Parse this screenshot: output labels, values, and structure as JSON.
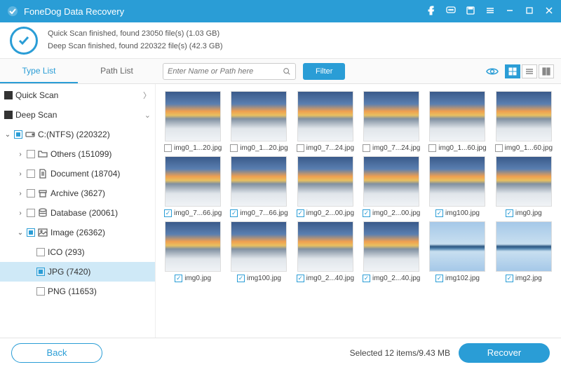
{
  "titlebar": {
    "title": "FoneDog Data Recovery"
  },
  "status": {
    "quick": "Quick Scan finished, found 23050 file(s) (1.03 GB)",
    "deep": "Deep Scan finished, found 220322 file(s) (42.3 GB)"
  },
  "tabs": {
    "typeList": "Type List",
    "pathList": "Path List"
  },
  "search": {
    "placeholder": "Enter Name or Path here"
  },
  "filter": "Filter",
  "tree": {
    "quickScan": "Quick Scan",
    "deepScan": "Deep Scan",
    "drive": "C:(NTFS) (220322)",
    "others": "Others (151099)",
    "document": "Document (18704)",
    "archive": "Archive (3627)",
    "database": "Database (20061)",
    "image": "Image (26362)",
    "ico": "ICO (293)",
    "jpg": "JPG (7420)",
    "png": "PNG (11653)"
  },
  "thumbs": [
    {
      "name": "img0_1...20.jpg",
      "checked": false,
      "variant": "sky"
    },
    {
      "name": "img0_1...20.jpg",
      "checked": false,
      "variant": "sky"
    },
    {
      "name": "img0_7...24.jpg",
      "checked": false,
      "variant": "sky"
    },
    {
      "name": "img0_7...24.jpg",
      "checked": false,
      "variant": "sky"
    },
    {
      "name": "img0_1...60.jpg",
      "checked": false,
      "variant": "sky"
    },
    {
      "name": "img0_1...60.jpg",
      "checked": false,
      "variant": "sky"
    },
    {
      "name": "img0_7...66.jpg",
      "checked": true,
      "variant": "sky"
    },
    {
      "name": "img0_7...66.jpg",
      "checked": true,
      "variant": "sky"
    },
    {
      "name": "img0_2...00.jpg",
      "checked": true,
      "variant": "sky"
    },
    {
      "name": "img0_2...00.jpg",
      "checked": true,
      "variant": "sky"
    },
    {
      "name": "img100.jpg",
      "checked": true,
      "variant": "sky"
    },
    {
      "name": "img0.jpg",
      "checked": true,
      "variant": "sky"
    },
    {
      "name": "img0.jpg",
      "checked": true,
      "variant": "sky"
    },
    {
      "name": "img100.jpg",
      "checked": true,
      "variant": "sky"
    },
    {
      "name": "img0_2...40.jpg",
      "checked": true,
      "variant": "sky"
    },
    {
      "name": "img0_2...40.jpg",
      "checked": true,
      "variant": "sky"
    },
    {
      "name": "img102.jpg",
      "checked": true,
      "variant": "island"
    },
    {
      "name": "img2.jpg",
      "checked": true,
      "variant": "island"
    }
  ],
  "footer": {
    "back": "Back",
    "selected": "Selected 12 items/9.43 MB",
    "recover": "Recover"
  }
}
